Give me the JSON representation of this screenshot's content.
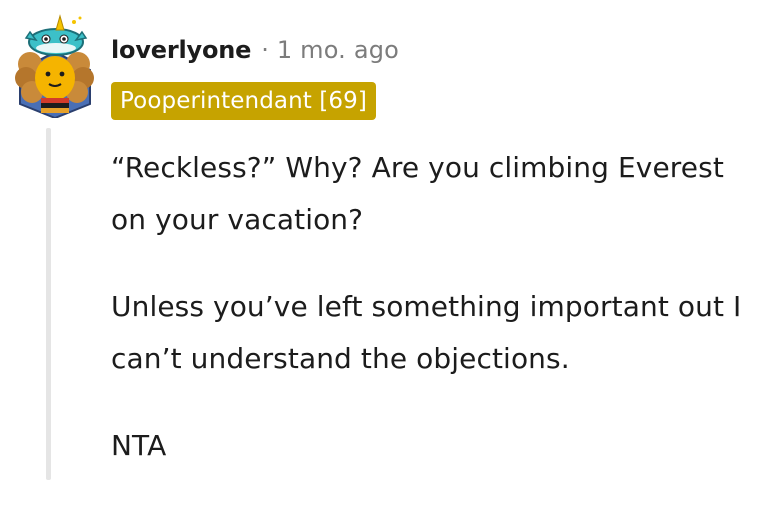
{
  "comment": {
    "username": "loverlyone",
    "separator": "·",
    "timestamp": "1 mo. ago",
    "flair": "Pooperintendant [69]",
    "paragraphs": [
      "“Reckless?” Why? Are you climbing Everest on your vacation?",
      "Unless you’ve left something important out I can’t understand the objections.",
      "NTA"
    ]
  },
  "colors": {
    "flair_background": "#c6a300",
    "flair_text": "#ffffff",
    "meta_gray": "#7c7c7c",
    "thread_line": "#e5e5e5",
    "text": "#1c1c1c"
  },
  "icons": {
    "avatar": "reddit-avatar-icon"
  }
}
